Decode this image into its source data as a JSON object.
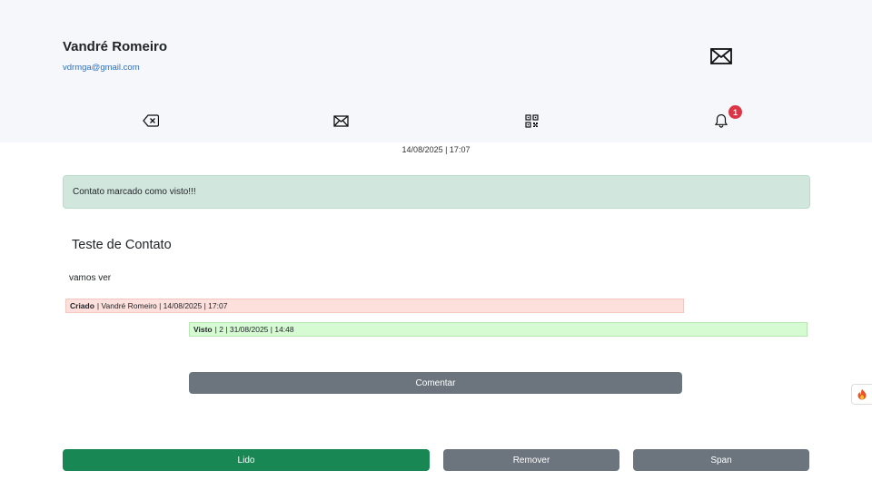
{
  "header": {
    "user_name": "Vandré Romeiro",
    "user_email": "vdrmga@gmail.com",
    "top_icon": "mail-icon"
  },
  "iconbar": {
    "items": [
      {
        "icon": "backspace-icon"
      },
      {
        "icon": "mail-icon"
      },
      {
        "icon": "qr-code-icon"
      },
      {
        "icon": "bell-icon",
        "badge": "1"
      }
    ]
  },
  "message": {
    "timestamp": "14/08/2025 | 17:07",
    "alert": "Contato marcado como visto!!!",
    "title": "Teste de Contato",
    "body": "vamos ver",
    "log_created": {
      "label": "Criado",
      "text": "| Vandré Romeiro | 14/08/2025 | 17:07"
    },
    "log_seen": {
      "label": "Visto",
      "text": "| 2 | 31/08/2025 | 14:48"
    }
  },
  "actions": {
    "comment": "Comentar",
    "read": "Lido",
    "remove": "Remover",
    "span": "Span"
  },
  "side_tab": {
    "icon": "flame-icon"
  },
  "colors": {
    "success": "#198754",
    "secondary": "#6c757d",
    "danger": "#dc3545",
    "alert_bg": "#d1e7dd",
    "created_bg": "#fde0dc",
    "seen_bg": "#d6fbd3"
  }
}
